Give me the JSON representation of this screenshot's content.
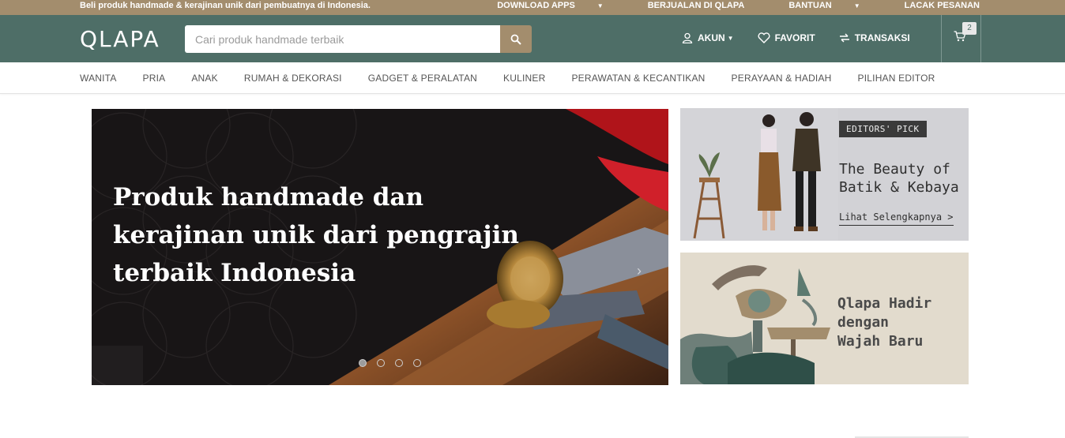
{
  "topbar": {
    "tagline": "Beli produk handmade & kerajinan unik dari pembuatnya di Indonesia.",
    "links": [
      {
        "label": "DOWNLOAD APPS",
        "dropdown": true
      },
      {
        "label": "BERJUALAN DI QLAPA",
        "dropdown": false
      },
      {
        "label": "BANTUAN",
        "dropdown": true
      },
      {
        "label": "LACAK PESANAN",
        "dropdown": false
      }
    ]
  },
  "header": {
    "logo": "QLAPA",
    "search": {
      "placeholder": "Cari produk handmade terbaik",
      "icon": "search-icon"
    },
    "nav": {
      "account": "AKUN",
      "favorite": "FAVORIT",
      "transactions": "TRANSAKSI"
    },
    "cart": {
      "count": "2",
      "icon": "cart-icon"
    }
  },
  "categories": [
    "WANITA",
    "PRIA",
    "ANAK",
    "RUMAH & DEKORASI",
    "GADGET & PERALATAN",
    "KULINER",
    "PERAWATAN & KECANTIKAN",
    "PERAYAAN & HADIAH",
    "PILIHAN EDITOR"
  ],
  "hero": {
    "lines": [
      "Produk handmade dan",
      "kerajinan unik dari pengrajin",
      "terbaik Indonesia"
    ],
    "slides": 4,
    "active_slide": 1
  },
  "promos": {
    "editors_pick": {
      "badge": "EDITORS' PICK",
      "title_lines": [
        "The Beauty of",
        "Batik & Kebaya"
      ],
      "link": "Lihat Selengkapnya >"
    },
    "new_look": {
      "title_lines": [
        "Qlapa Hadir",
        "dengan",
        "Wajah Baru"
      ]
    }
  },
  "colors": {
    "topbar": "#a38d6d",
    "header": "#4e6e67",
    "accent": "#a38d6d"
  }
}
